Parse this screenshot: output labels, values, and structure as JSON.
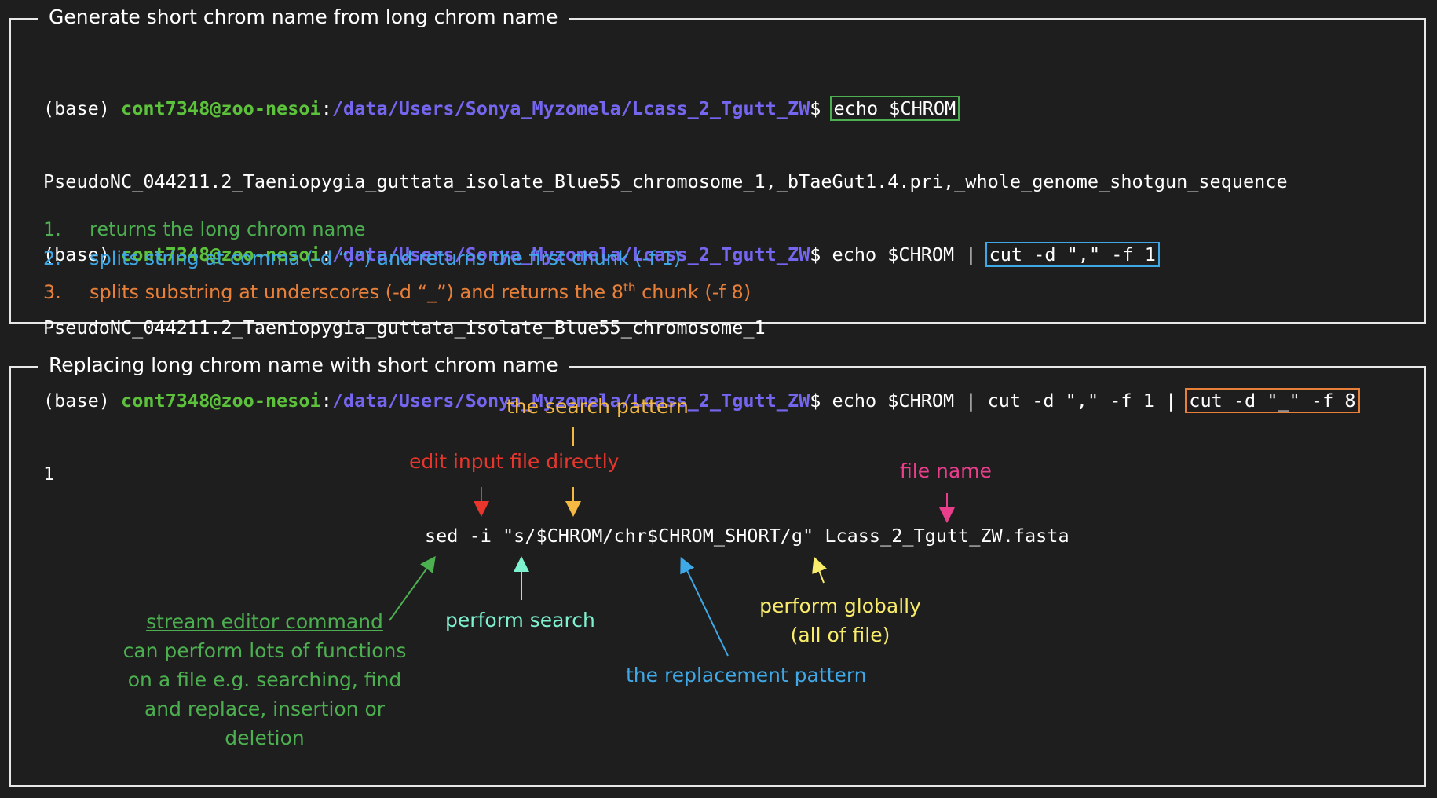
{
  "section1": {
    "title": "Generate short chrom name from long chrom name",
    "terminal": {
      "prompt_base": "(base) ",
      "prompt_user": "cont7348@zoo-nesoi",
      "prompt_colon": ":",
      "prompt_path": "/data/Users/Sonya_Myzomela/Lcass_2_Tgutt_ZW",
      "prompt_dollar": "$ ",
      "cmd1": "echo $CHROM",
      "out1": "PseudoNC_044211.2_Taeniopygia_guttata_isolate_Blue55_chromosome_1,_bTaeGut1.4.pri,_whole_genome_shotgun_sequence",
      "cmd2_prefix": "echo $CHROM | ",
      "cmd2_boxed": "cut -d \",\" -f 1",
      "out2": "PseudoNC_044211.2_Taeniopygia_guttata_isolate_Blue55_chromosome_1",
      "cmd3_prefix": "echo $CHROM | cut -d \",\" -f 1 | ",
      "cmd3_boxed": "cut -d \"_\" -f 8",
      "out3": "1"
    },
    "steps": [
      {
        "num": "1.",
        "text": "returns the long chrom name",
        "color": "#4caf50"
      },
      {
        "num": "2.",
        "text": "splits string at comma (-d “,”) and returns the first chunk (-f 1)",
        "color": "#3fa8e6"
      },
      {
        "num": "3.",
        "text_before": "splits substring at underscores (-d “_”) and returns the 8",
        "sup": "th",
        "text_after": " chunk (-f 8)",
        "color": "#e8803a"
      }
    ],
    "box_colors": {
      "cmd1": "#4caf50",
      "cmd2": "#3fa8e6",
      "cmd3": "#e8803a"
    }
  },
  "section2": {
    "title": "Replacing long chrom name with short chrom name",
    "command": "sed -i \"s/$CHROM/chr$CHROM_SHORT/g\" Lcass_2_Tgutt_ZW.fasta",
    "labels": {
      "search_pattern": {
        "text": "the search pattern",
        "color": "#f4b942"
      },
      "edit_input": {
        "text": "edit input file directly",
        "color": "#e8362d"
      },
      "file_name": {
        "text": "file name",
        "color": "#e83e8c"
      },
      "stream_title": {
        "text": "stream editor command",
        "color": "#4caf50"
      },
      "stream_desc": {
        "lines": [
          "can perform lots of functions",
          "on a file e.g. searching, find",
          "and replace, insertion or",
          "deletion"
        ],
        "color": "#4caf50"
      },
      "perform_search": {
        "text": "perform search",
        "color": "#7ef2cf"
      },
      "replacement": {
        "text": "the replacement pattern",
        "color": "#3fa8e6"
      },
      "globally": {
        "lines": [
          "perform globally",
          "(all of file)"
        ],
        "color": "#f8ec6a"
      }
    }
  }
}
